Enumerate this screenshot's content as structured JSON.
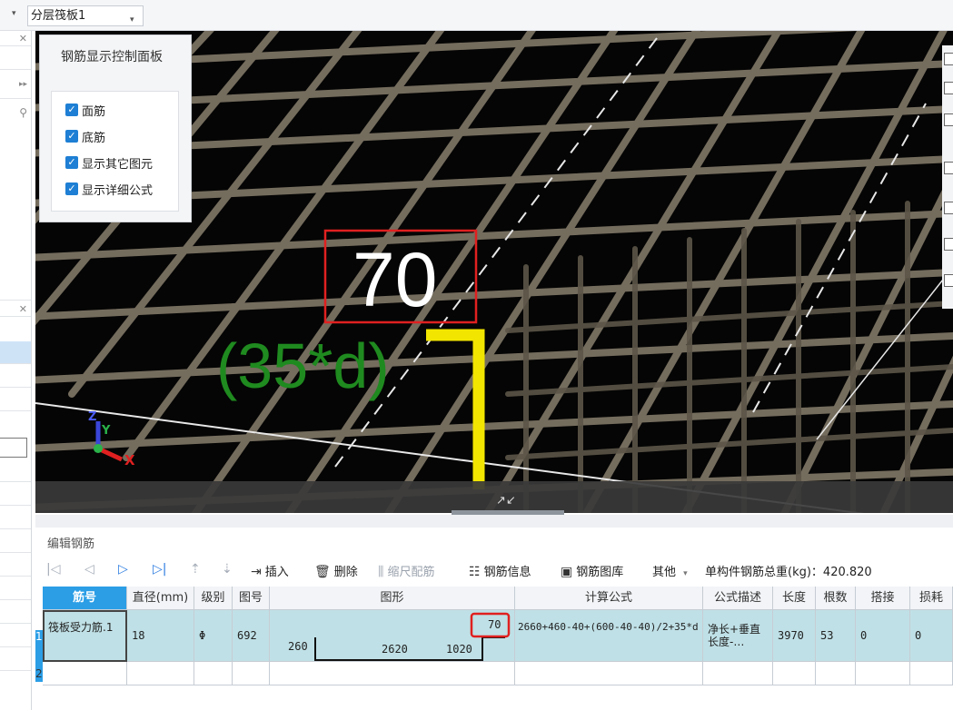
{
  "top_bar": {
    "layer_select_value": "分层筏板1"
  },
  "viewport": {
    "dimension_label": "70",
    "formula_label": "(35*d)",
    "axis_z": "Z",
    "axis_y": "Y",
    "axis_x": "X"
  },
  "control_panel": {
    "title": "钢筋显示控制面板",
    "options": [
      {
        "label": "面筋",
        "checked": true
      },
      {
        "label": "底筋",
        "checked": true
      },
      {
        "label": "显示其它图元",
        "checked": true
      },
      {
        "label": "显示详细公式",
        "checked": true
      }
    ]
  },
  "edit_panel": {
    "title": "编辑钢筋",
    "toolbar": {
      "insert": "插入",
      "delete": "删除",
      "scale_rebar": "缩尺配筋",
      "rebar_info": "钢筋信息",
      "rebar_library": "钢筋图库",
      "other": "其他",
      "total_weight": "单构件钢筋总重(kg)：420.820"
    },
    "columns": [
      "筋号",
      "直径(mm)",
      "级别",
      "图号",
      "图形",
      "计算公式",
      "公式描述",
      "长度",
      "根数",
      "搭接",
      "损耗"
    ],
    "rows": [
      {
        "row_number": "1",
        "bar_name": "筏板受力筋.1",
        "diameter": "18",
        "grade": "Φ",
        "figure_number": "692",
        "shape": {
          "left": "260",
          "middle": "2620",
          "right": "1020",
          "top": "70"
        },
        "formula": "2660+460-40+(600-40-40)/2+35*d",
        "description": "净长+垂直长度-…",
        "length": "3970",
        "count": "53",
        "lap": "0",
        "loss": "0"
      },
      {
        "row_number": "2"
      }
    ]
  }
}
